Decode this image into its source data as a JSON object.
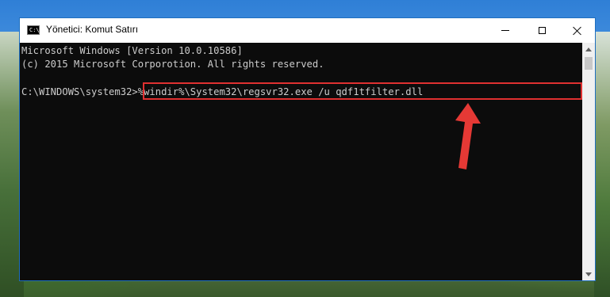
{
  "window": {
    "title": "Yönetici: Komut Satırı",
    "icon": "cmd-icon",
    "icon_text": "C:\\"
  },
  "console": {
    "lines": [
      "Microsoft Windows [Version 10.0.10586]",
      "(c) 2015 Microsoft Corporotion. All rights reserved.",
      "C:\\WINDOWS\\system32>%windir%\\System32\\regsvr32.exe /u qdf1tfilter.dll"
    ]
  },
  "colors": {
    "console_bg": "#0c0c0c",
    "console_text": "#cccccc",
    "highlight": "#e03030",
    "arrow": "#e03030"
  }
}
